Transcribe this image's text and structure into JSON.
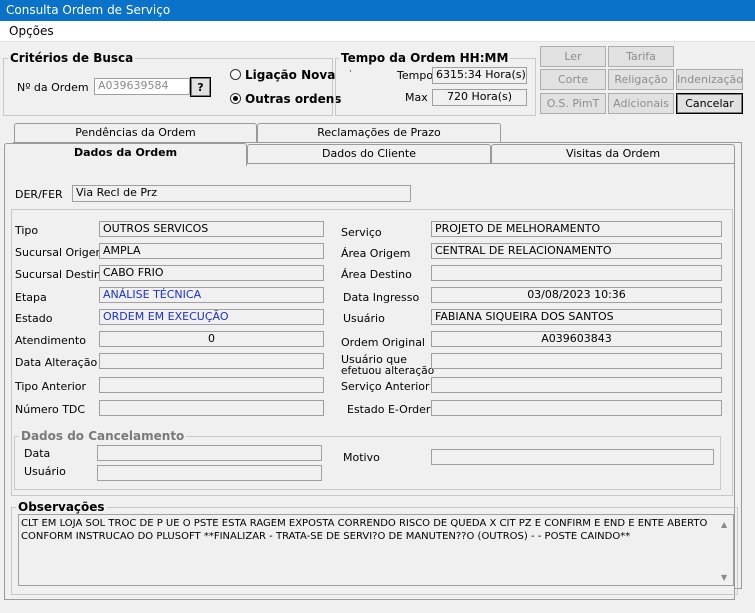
{
  "window": {
    "title": "Consulta Ordem de Serviço"
  },
  "menu": {
    "opcoes": "Opções"
  },
  "criterios": {
    "title": "Critérios de Busca",
    "num_ordem_label": "Nº da Ordem",
    "num_ordem_value": "A039639584",
    "help_button": "?",
    "radio_ligacao": "Ligação Nova",
    "radio_outras": "Outras ordens",
    "selected": "Outras ordens"
  },
  "tempo": {
    "title": "Tempo da Ordem HH:MM",
    "dot": "·",
    "tempo_label": "Tempo",
    "tempo_value": "6315:34 Hora(s)",
    "max_label": "Max",
    "max_value": "720 Hora(s)"
  },
  "buttons": {
    "ler": "Ler",
    "tarifa": "Tarifa",
    "corte": "Corte",
    "religacao": "Religação",
    "indenizacao": "Indenização",
    "os_pimt": "O.S. PimT",
    "adicionais": "Adicionais",
    "cancelar": "Cancelar"
  },
  "tabs_top": {
    "pendencias": "Pendências da Ordem",
    "reclamacoes": "Reclamações de Prazo"
  },
  "tabs_bottom": {
    "dados_ordem": "Dados da Ordem",
    "dados_cliente": "Dados do Cliente",
    "visitas": "Visitas da Ordem"
  },
  "der": {
    "label": "DER/FER",
    "value": "Via Recl de Prz"
  },
  "left": {
    "tipo": {
      "label": "Tipo",
      "value": "OUTROS SERVICOS"
    },
    "sucursal_origem": {
      "label": "Sucursal Origem",
      "value": "AMPLA"
    },
    "sucursal_destino": {
      "label": "Sucursal Destino",
      "value": "CABO FRIO"
    },
    "etapa": {
      "label": "Etapa",
      "value": "ANÁLISE TÉCNICA"
    },
    "estado": {
      "label": "Estado",
      "value": "ORDEM EM EXECUÇÃO"
    },
    "atendimento": {
      "label": "Atendimento",
      "value": "0"
    },
    "data_alteracao": {
      "label": "Data Alteração",
      "value": ""
    },
    "tipo_anterior": {
      "label": "Tipo Anterior",
      "value": ""
    },
    "numero_tdc": {
      "label": "Número TDC",
      "value": ""
    }
  },
  "right": {
    "servico": {
      "label": "Serviço",
      "value": "PROJETO DE MELHORAMENTO"
    },
    "area_origem": {
      "label": "Área Origem",
      "value": "CENTRAL DE RELACIONAMENTO"
    },
    "area_destino": {
      "label": "Área Destino",
      "value": ""
    },
    "data_ingresso": {
      "label": "Data Ingresso",
      "value": "03/08/2023 10:36"
    },
    "usuario": {
      "label": "Usuário",
      "value": "FABIANA SIQUEIRA DOS SANTOS"
    },
    "ordem_original": {
      "label": "Ordem Original",
      "value": "A039603843"
    },
    "usuario_alteracao": {
      "label_1": "Usuário que",
      "label_2": "efetuou alteração",
      "value": ""
    },
    "servico_anterior": {
      "label": "Serviço Anterior",
      "value": ""
    },
    "estado_eorder": {
      "label": "Estado E-Order",
      "value": ""
    }
  },
  "cancelamento": {
    "title": "Dados do Cancelamento",
    "data_label": "Data",
    "data_value": "",
    "usuario_label": "Usuário",
    "usuario_value": "",
    "motivo_label": "Motivo",
    "motivo_value": ""
  },
  "observacoes": {
    "title": "Observações",
    "text": "CLT EM LOJA SOL TROC DE P                    UE O PSTE ESTA              RAGEM EXPOSTA CORRENDO RISCO DE QUEDA X CIT PZ E CONFIRM E END E ENTE                ABERTO CONFORM INSTRUCAO DO PLUSOFT **FINALIZAR - TRATA-SE DE SERVI?O DE MANUTEN??O (OUTROS) - - POSTE CAINDO**"
  },
  "icons": {
    "scroll_up": "up-arrow-icon",
    "scroll_down": "down-arrow-icon"
  }
}
